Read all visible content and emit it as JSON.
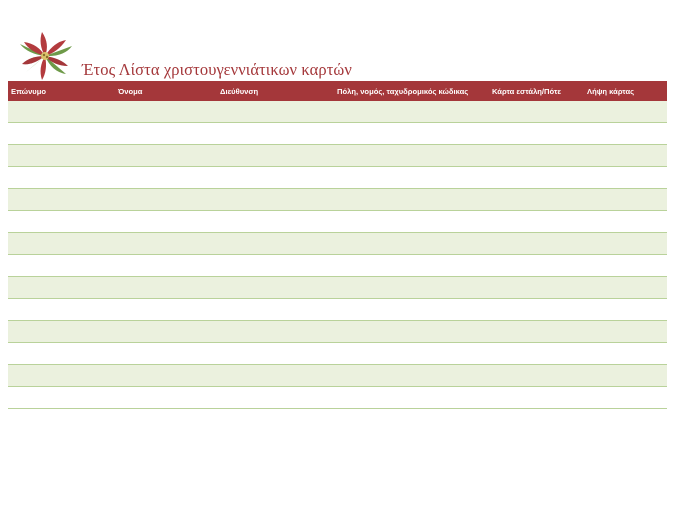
{
  "document": {
    "title": "Έτος Λίστα χριστουγεννιάτικων καρτών"
  },
  "table": {
    "columns": [
      "Επώνυμο",
      "Όνομα",
      "Διεύθυνση",
      "Πόλη, νομός, ταχυδρομικός κώδικας",
      "Κάρτα εστάλη/Πότε",
      "Λήψη κάρτας"
    ],
    "row_count": 14,
    "colors": {
      "header": "#a4373a",
      "shaded_row": "#ebf1de",
      "row_border": "#b9d29a"
    }
  }
}
